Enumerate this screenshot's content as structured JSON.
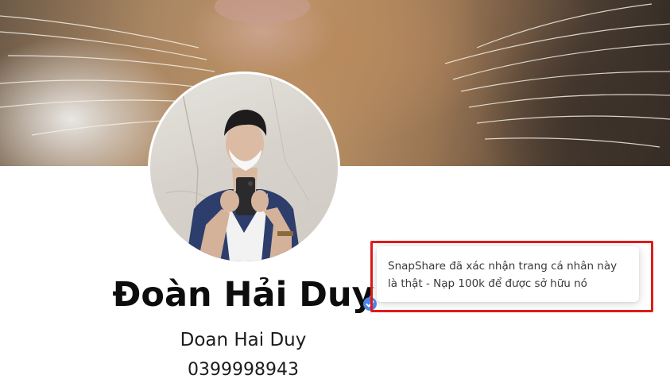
{
  "profile": {
    "display_name": "Đoàn Hải Duy",
    "alt_name": "Doan Hai Duy",
    "phone": "0399998943",
    "verified_color": "#4f86e8"
  },
  "tooltip": {
    "message": "SnapShare đã xác nhận trang cá nhân này là thật - Nạp 100k để được sở hữu nó",
    "highlight_color": "#e11b1b"
  }
}
